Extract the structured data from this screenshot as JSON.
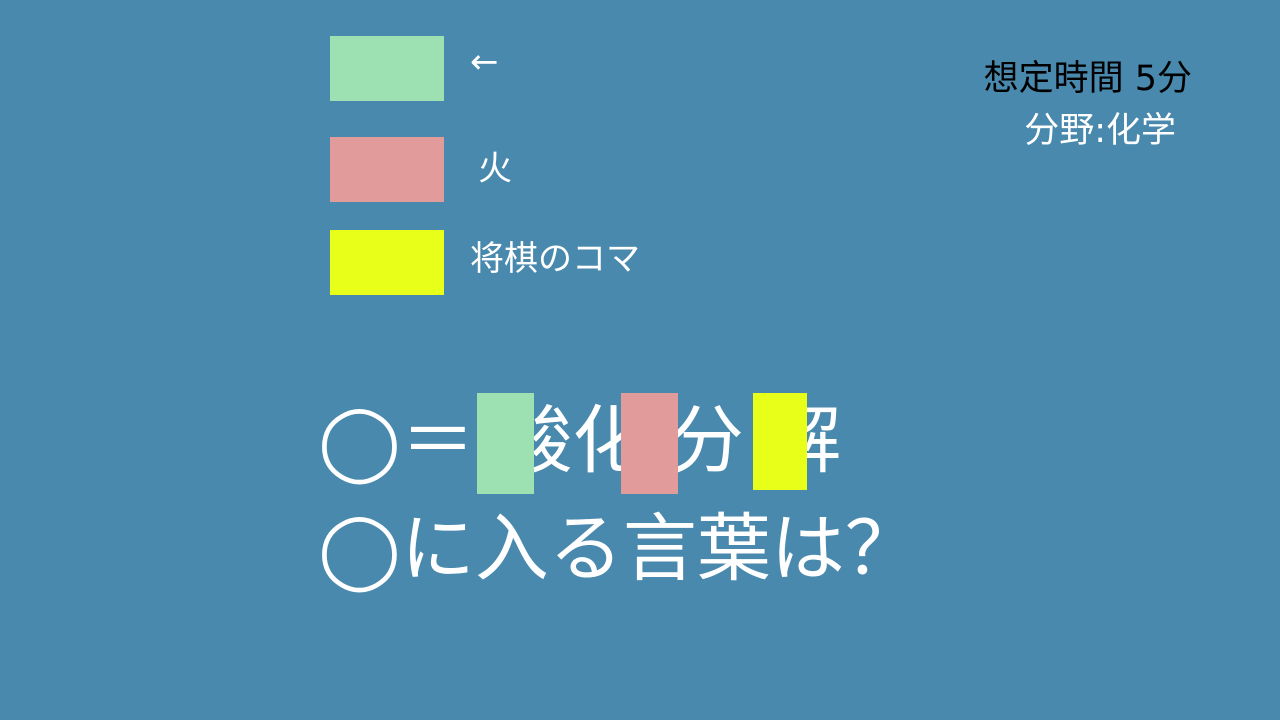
{
  "slide": {
    "background": "#4989ad"
  },
  "legend": {
    "items": [
      {
        "color": "#9de0b2",
        "label": "←"
      },
      {
        "color": "#e09b9a",
        "label": "火"
      },
      {
        "color": "#e8ff1a",
        "label": "将棋のコマ"
      }
    ]
  },
  "info": {
    "time_label": "想定時間 5分",
    "field_label": "分野:化学"
  },
  "puzzle": {
    "text": "◯＝ 酸化 分 解",
    "blocks": [
      {
        "color": "#9de0b2"
      },
      {
        "color": "#e09b9a"
      },
      {
        "color": "#e8ff1a"
      }
    ]
  },
  "question": {
    "text": "◯に入る言葉は？"
  }
}
